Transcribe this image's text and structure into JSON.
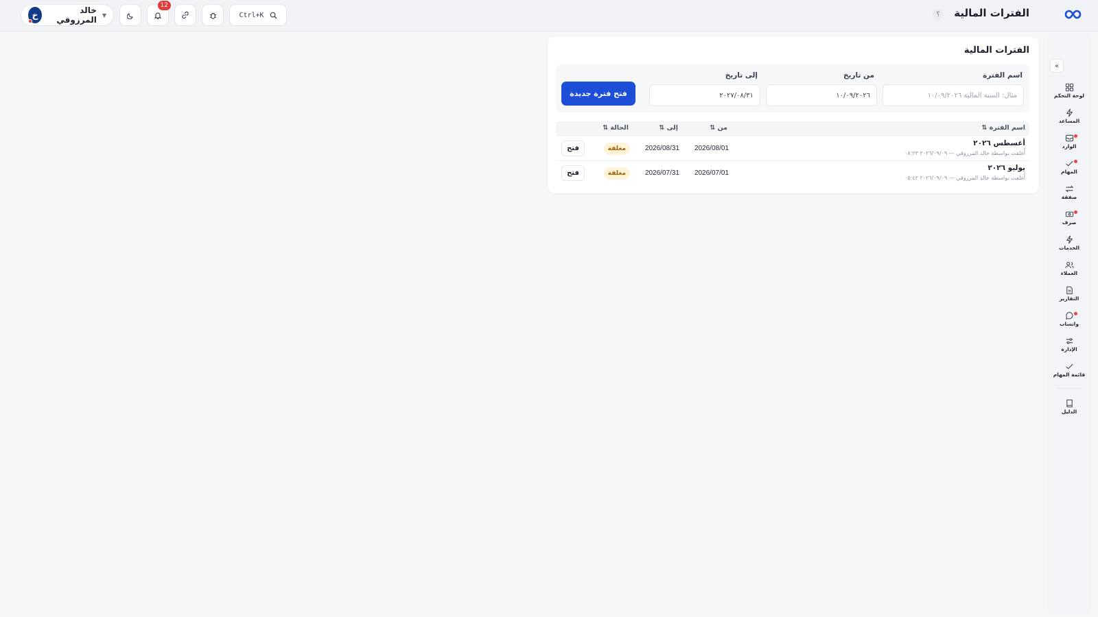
{
  "header": {
    "page_title": "الفترات المالية",
    "help_glyph": "؟",
    "search_shortcut": "Ctrl+K",
    "notification_count": "12",
    "user": {
      "name": "خالد المرزوقي",
      "initial": "خ"
    }
  },
  "sidebar": {
    "items": [
      {
        "label": "لوحة التحكم",
        "icon": "dashboard-icon"
      },
      {
        "label": "المساعد",
        "icon": "bolt-icon"
      },
      {
        "label": "الوارد",
        "icon": "inbox-icon"
      },
      {
        "label": "المهام",
        "icon": "check-icon"
      },
      {
        "label": "صفقة",
        "icon": "swap-icon"
      },
      {
        "label": "صرف",
        "icon": "cash-icon"
      },
      {
        "label": "الخدمات",
        "icon": "bolt-icon"
      },
      {
        "label": "العملاء",
        "icon": "users-icon"
      },
      {
        "label": "التقارير",
        "icon": "report-icon"
      },
      {
        "label": "واتساب",
        "icon": "chat-icon"
      },
      {
        "label": "الإدارة",
        "icon": "sliders-icon"
      },
      {
        "label": "قائمة المهام",
        "icon": "check-icon"
      }
    ],
    "guide_label": "الدليل"
  },
  "card": {
    "title": "الفترات المالية",
    "form": {
      "period_name_label": "اسم الفترة",
      "period_name_placeholder": "مثال: السنة المالية ١٠/٠٩/٢٠٢٦",
      "from_label": "من تاريخ",
      "from_value": "١٠/٠٩/٢٠٢٦",
      "to_label": "إلى تاريخ",
      "to_value": "٢٠٢٧/٠٨/٣١",
      "submit_label": "فتح فترة جديدة"
    },
    "table": {
      "columns": [
        "اسم الفترة ⇅",
        "من ⇅",
        "إلى ⇅",
        "الحالة ⇅"
      ],
      "rows": [
        {
          "name": "أغسطس ٢٠٢٦",
          "meta": "أُغلقت بواسطة خالد المرزوقي — ٢٠٢٦/٠٩/٠٩ ٠٨:٢٣",
          "from": "2026/08/01",
          "to": "2026/08/31",
          "status": "مغلقة",
          "action": "فتح"
        },
        {
          "name": "يوليو ٢٠٢٦",
          "meta": "أُغلقت بواسطة خالد المرزوقي — ٢٠٢٦/٠٩/٠٩ ٠٥:٤٢",
          "from": "2026/07/01",
          "to": "2026/07/31",
          "status": "مغلقة",
          "action": "فتح"
        }
      ]
    }
  },
  "colors": {
    "primary": "#1d4ed8",
    "status_closed_bg": "#fdf3d8",
    "status_closed_text": "#a16207",
    "badge": "#e23b3b"
  }
}
